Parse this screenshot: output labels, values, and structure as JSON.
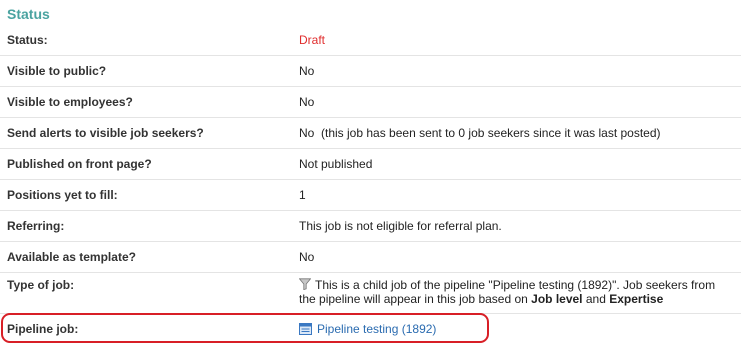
{
  "section": {
    "title": "Status"
  },
  "rows": {
    "status": {
      "label": "Status:",
      "value": "Draft"
    },
    "visible_public": {
      "label": "Visible to public?",
      "value": "No"
    },
    "visible_employees": {
      "label": "Visible to employees?",
      "value": "No"
    },
    "send_alerts": {
      "label": "Send alerts to visible job seekers?",
      "value": "No  (this job has been sent to 0 job seekers since it was last posted)"
    },
    "published_front": {
      "label": "Published on front page?",
      "value": "Not published"
    },
    "positions": {
      "label": "Positions yet to fill:",
      "value": "1"
    },
    "referring": {
      "label": "Referring:",
      "value": "This job is not eligible for referral plan."
    },
    "template": {
      "label": "Available as template?",
      "value": "No"
    },
    "type_of_job": {
      "label": "Type of job:",
      "text_before": "This is a child job of the pipeline \"Pipeline testing (1892)\". Job seekers from the pipeline will appear in this job based on ",
      "bold1": "Job level",
      "and": " and ",
      "bold2": "Expertise",
      "icon": "funnel-icon"
    },
    "pipeline_job": {
      "label": "Pipeline job:",
      "link": "Pipeline testing (1892)",
      "icon": "job-icon"
    }
  },
  "colors": {
    "title": "#4aa3a0",
    "draft": "#e02d2d",
    "link": "#2a6bb0",
    "highlight": "#d81f26"
  }
}
